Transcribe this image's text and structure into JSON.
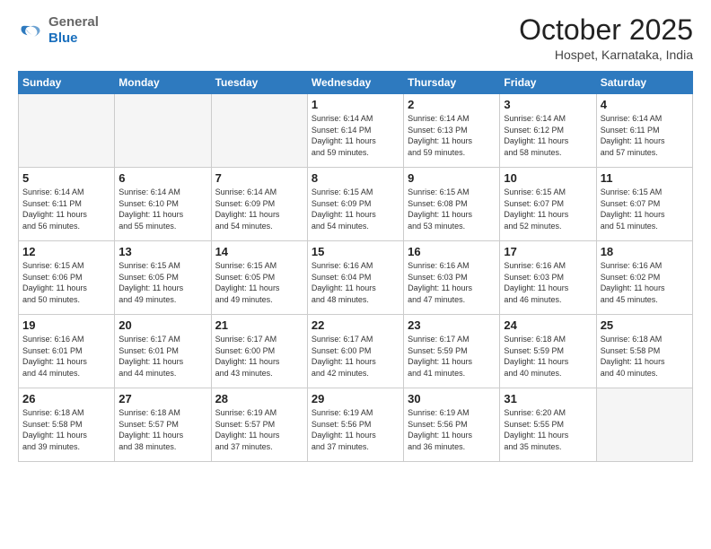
{
  "header": {
    "logo_general": "General",
    "logo_blue": "Blue",
    "month_title": "October 2025",
    "location": "Hospet, Karnataka, India"
  },
  "days_of_week": [
    "Sunday",
    "Monday",
    "Tuesday",
    "Wednesday",
    "Thursday",
    "Friday",
    "Saturday"
  ],
  "weeks": [
    [
      {
        "day": "",
        "info": ""
      },
      {
        "day": "",
        "info": ""
      },
      {
        "day": "",
        "info": ""
      },
      {
        "day": "1",
        "info": "Sunrise: 6:14 AM\nSunset: 6:14 PM\nDaylight: 11 hours\nand 59 minutes."
      },
      {
        "day": "2",
        "info": "Sunrise: 6:14 AM\nSunset: 6:13 PM\nDaylight: 11 hours\nand 59 minutes."
      },
      {
        "day": "3",
        "info": "Sunrise: 6:14 AM\nSunset: 6:12 PM\nDaylight: 11 hours\nand 58 minutes."
      },
      {
        "day": "4",
        "info": "Sunrise: 6:14 AM\nSunset: 6:11 PM\nDaylight: 11 hours\nand 57 minutes."
      }
    ],
    [
      {
        "day": "5",
        "info": "Sunrise: 6:14 AM\nSunset: 6:11 PM\nDaylight: 11 hours\nand 56 minutes."
      },
      {
        "day": "6",
        "info": "Sunrise: 6:14 AM\nSunset: 6:10 PM\nDaylight: 11 hours\nand 55 minutes."
      },
      {
        "day": "7",
        "info": "Sunrise: 6:14 AM\nSunset: 6:09 PM\nDaylight: 11 hours\nand 54 minutes."
      },
      {
        "day": "8",
        "info": "Sunrise: 6:15 AM\nSunset: 6:09 PM\nDaylight: 11 hours\nand 54 minutes."
      },
      {
        "day": "9",
        "info": "Sunrise: 6:15 AM\nSunset: 6:08 PM\nDaylight: 11 hours\nand 53 minutes."
      },
      {
        "day": "10",
        "info": "Sunrise: 6:15 AM\nSunset: 6:07 PM\nDaylight: 11 hours\nand 52 minutes."
      },
      {
        "day": "11",
        "info": "Sunrise: 6:15 AM\nSunset: 6:07 PM\nDaylight: 11 hours\nand 51 minutes."
      }
    ],
    [
      {
        "day": "12",
        "info": "Sunrise: 6:15 AM\nSunset: 6:06 PM\nDaylight: 11 hours\nand 50 minutes."
      },
      {
        "day": "13",
        "info": "Sunrise: 6:15 AM\nSunset: 6:05 PM\nDaylight: 11 hours\nand 49 minutes."
      },
      {
        "day": "14",
        "info": "Sunrise: 6:15 AM\nSunset: 6:05 PM\nDaylight: 11 hours\nand 49 minutes."
      },
      {
        "day": "15",
        "info": "Sunrise: 6:16 AM\nSunset: 6:04 PM\nDaylight: 11 hours\nand 48 minutes."
      },
      {
        "day": "16",
        "info": "Sunrise: 6:16 AM\nSunset: 6:03 PM\nDaylight: 11 hours\nand 47 minutes."
      },
      {
        "day": "17",
        "info": "Sunrise: 6:16 AM\nSunset: 6:03 PM\nDaylight: 11 hours\nand 46 minutes."
      },
      {
        "day": "18",
        "info": "Sunrise: 6:16 AM\nSunset: 6:02 PM\nDaylight: 11 hours\nand 45 minutes."
      }
    ],
    [
      {
        "day": "19",
        "info": "Sunrise: 6:16 AM\nSunset: 6:01 PM\nDaylight: 11 hours\nand 44 minutes."
      },
      {
        "day": "20",
        "info": "Sunrise: 6:17 AM\nSunset: 6:01 PM\nDaylight: 11 hours\nand 44 minutes."
      },
      {
        "day": "21",
        "info": "Sunrise: 6:17 AM\nSunset: 6:00 PM\nDaylight: 11 hours\nand 43 minutes."
      },
      {
        "day": "22",
        "info": "Sunrise: 6:17 AM\nSunset: 6:00 PM\nDaylight: 11 hours\nand 42 minutes."
      },
      {
        "day": "23",
        "info": "Sunrise: 6:17 AM\nSunset: 5:59 PM\nDaylight: 11 hours\nand 41 minutes."
      },
      {
        "day": "24",
        "info": "Sunrise: 6:18 AM\nSunset: 5:59 PM\nDaylight: 11 hours\nand 40 minutes."
      },
      {
        "day": "25",
        "info": "Sunrise: 6:18 AM\nSunset: 5:58 PM\nDaylight: 11 hours\nand 40 minutes."
      }
    ],
    [
      {
        "day": "26",
        "info": "Sunrise: 6:18 AM\nSunset: 5:58 PM\nDaylight: 11 hours\nand 39 minutes."
      },
      {
        "day": "27",
        "info": "Sunrise: 6:18 AM\nSunset: 5:57 PM\nDaylight: 11 hours\nand 38 minutes."
      },
      {
        "day": "28",
        "info": "Sunrise: 6:19 AM\nSunset: 5:57 PM\nDaylight: 11 hours\nand 37 minutes."
      },
      {
        "day": "29",
        "info": "Sunrise: 6:19 AM\nSunset: 5:56 PM\nDaylight: 11 hours\nand 37 minutes."
      },
      {
        "day": "30",
        "info": "Sunrise: 6:19 AM\nSunset: 5:56 PM\nDaylight: 11 hours\nand 36 minutes."
      },
      {
        "day": "31",
        "info": "Sunrise: 6:20 AM\nSunset: 5:55 PM\nDaylight: 11 hours\nand 35 minutes."
      },
      {
        "day": "",
        "info": ""
      }
    ]
  ]
}
